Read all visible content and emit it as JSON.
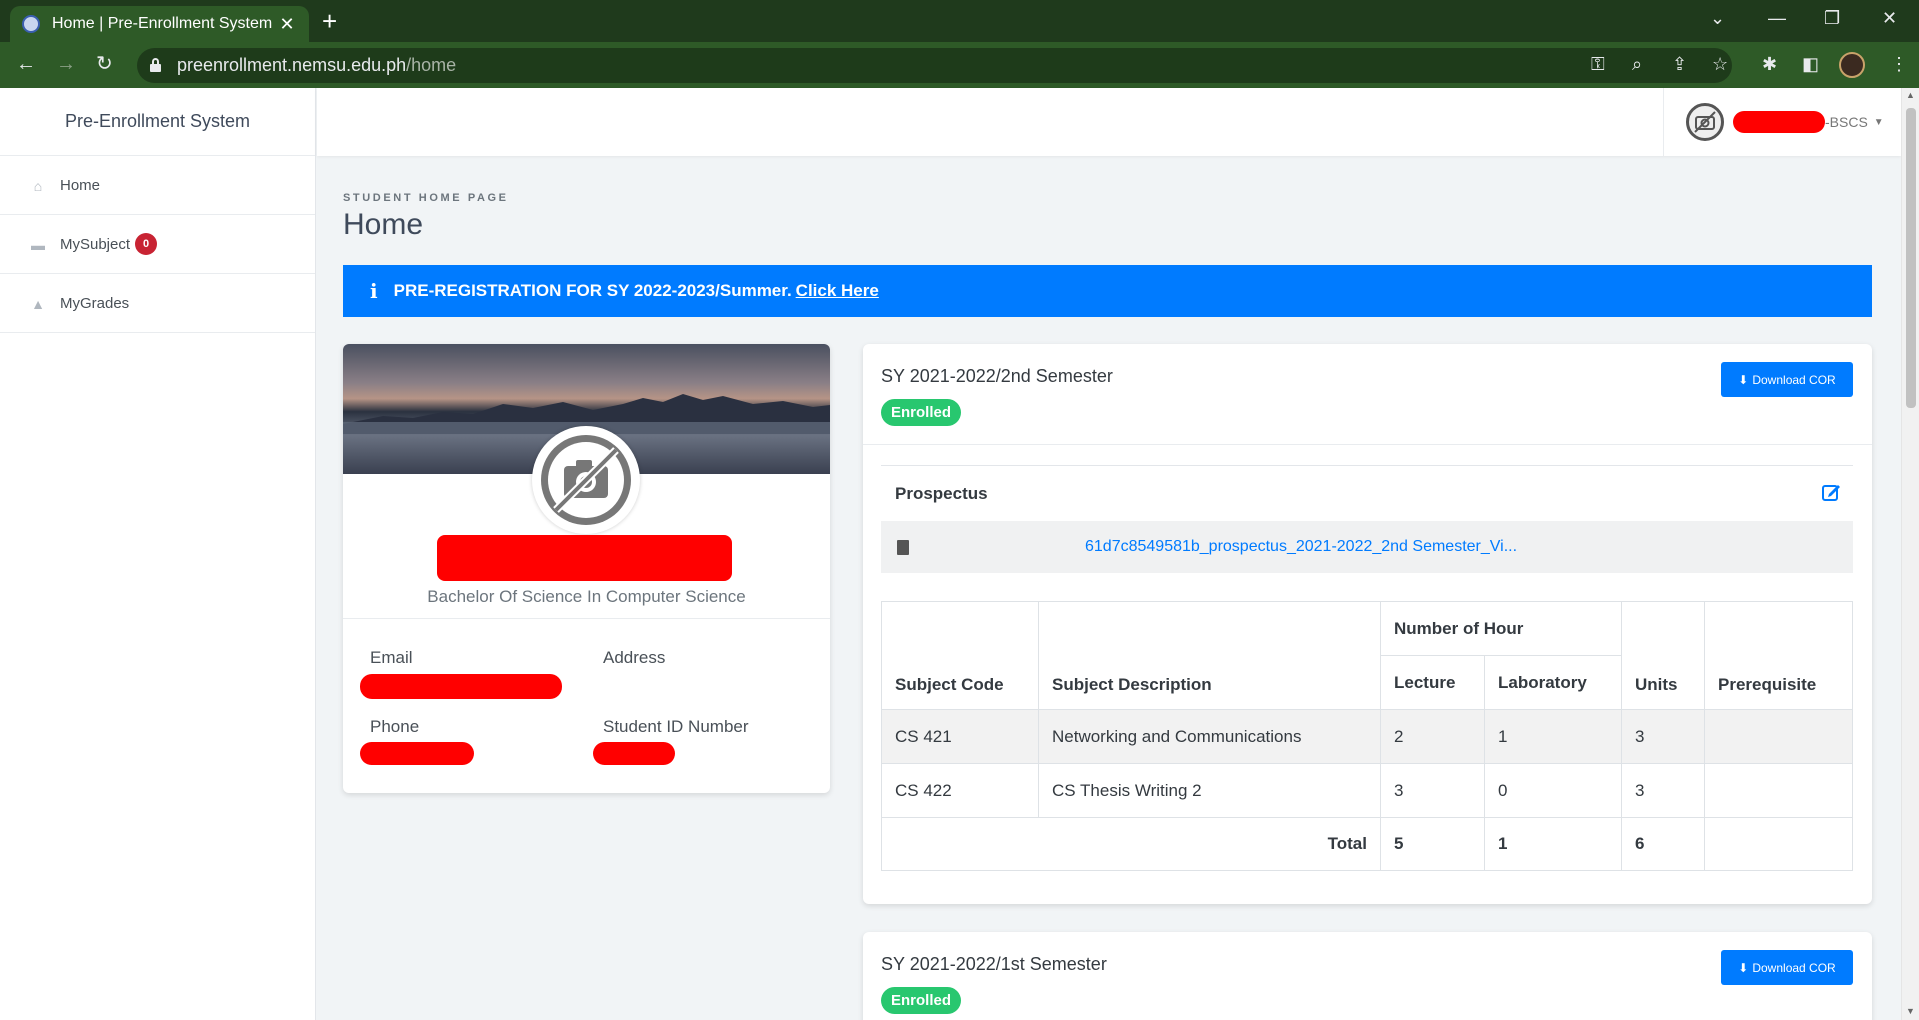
{
  "browser": {
    "tab_title": "Home | Pre-Enrollment System",
    "url_host": "preenrollment.nemsu.edu.ph",
    "url_path": "/home"
  },
  "sidebar": {
    "brand": "Pre-Enrollment System",
    "items": [
      {
        "label": "Home",
        "icon": "home-icon"
      },
      {
        "label": "MySubject",
        "icon": "folder-icon",
        "badge": "0"
      },
      {
        "label": "MyGrades",
        "icon": "graduation-cap-icon"
      }
    ]
  },
  "user": {
    "role_suffix": "-BSCS"
  },
  "page": {
    "eyebrow": "STUDENT HOME PAGE",
    "title": "Home"
  },
  "alert": {
    "text": "PRE-REGISTRATION FOR SY 2022-2023/Summer.",
    "link": "Click Here"
  },
  "profile": {
    "program": "Bachelor Of Science In Computer Science",
    "email_label": "Email",
    "address_label": "Address",
    "phone_label": "Phone",
    "student_id_label": "Student ID Number"
  },
  "semesters": [
    {
      "title": "SY 2021-2022/2nd Semester",
      "status": "Enrolled",
      "download_label": "Download COR",
      "prospectus_label": "Prospectus",
      "prospectus_file": "61d7c8549581b_prospectus_2021-2022_2nd Semester_Vi...",
      "table": {
        "headers": {
          "subject_code": "Subject Code",
          "subject_description": "Subject Description",
          "number_of_hour": "Number of Hour",
          "lecture": "Lecture",
          "laboratory": "Laboratory",
          "units": "Units",
          "prerequisite": "Prerequisite"
        },
        "rows": [
          {
            "code": "CS 421",
            "description": "Networking and Communications",
            "lecture": "2",
            "laboratory": "1",
            "units": "3",
            "prerequisite": ""
          },
          {
            "code": "CS 422",
            "description": "CS Thesis Writing 2",
            "lecture": "3",
            "laboratory": "0",
            "units": "3",
            "prerequisite": ""
          }
        ],
        "total": {
          "label": "Total",
          "lecture": "5",
          "laboratory": "1",
          "units": "6"
        }
      }
    },
    {
      "title": "SY 2021-2022/1st Semester",
      "status": "Enrolled",
      "download_label": "Download COR"
    }
  ],
  "colors": {
    "primary": "#007bff",
    "success": "#28c76f",
    "danger": "#c82333",
    "browser_chrome": "#2e5a27"
  }
}
